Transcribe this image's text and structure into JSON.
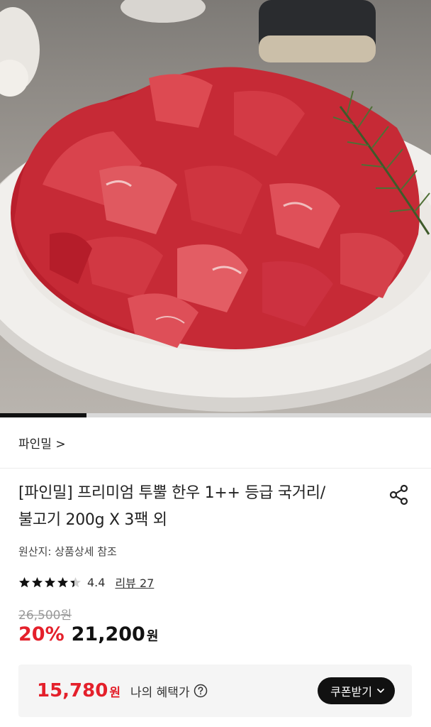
{
  "product_image": {
    "label": "product-photo",
    "carousel_progress": 0.2
  },
  "brand": {
    "name": "파인밀 >"
  },
  "product": {
    "title_line1": "[파인밀] 프리미엄 투뿔 한우 1++ 등급 국거리/",
    "title_line2": "불고기 200g X 3팩 외",
    "origin": "원산지: 상품상세 참조",
    "rating": "4.4",
    "rating_stars": 4.4,
    "review_label": "리뷰 27",
    "original_price": "26,500원",
    "discount": "20%",
    "price": "21,200",
    "price_unit": "원"
  },
  "benefit": {
    "price": "15,780",
    "price_unit": "원",
    "label": "나의 혜택가",
    "coupon_button": "쿠폰받기"
  },
  "colors": {
    "accent": "#e4202b",
    "dark": "#111111",
    "meat": "#c62a36"
  },
  "icons": {
    "share": "share-icon",
    "help": "question-circle-icon",
    "chevron": "chevron-down-icon"
  }
}
